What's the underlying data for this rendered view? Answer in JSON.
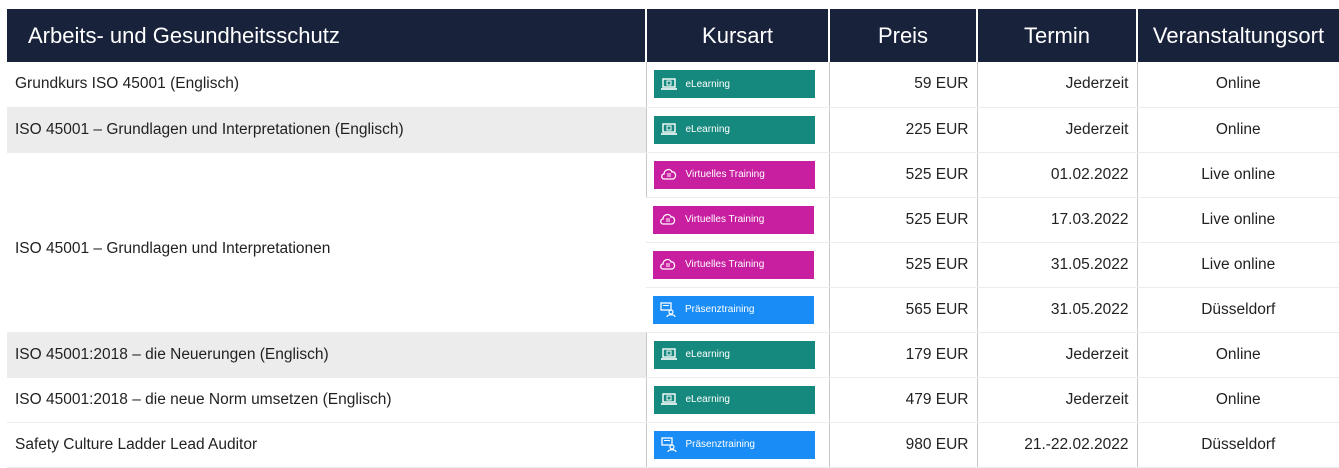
{
  "table": {
    "headers": {
      "title": "Arbeits- und Gesundheitsschutz",
      "type": "Kursart",
      "price": "Preis",
      "date": "Termin",
      "venue": "Veranstaltungsort"
    },
    "badge_types": {
      "elearning": {
        "label": "eLearning",
        "icon": "laptop-icon",
        "color": "#16897e"
      },
      "virtual": {
        "label": "Virtuelles Training",
        "icon": "cloud-document-icon",
        "color": "#c81ea0"
      },
      "presence": {
        "label": "Präsenztraining",
        "icon": "classroom-icon",
        "color": "#1a8cf5"
      }
    },
    "rows": [
      {
        "title": "Grundkurs ISO 45001 (Englisch)",
        "type_label": "eLearning",
        "price": "59 EUR",
        "date": "Jederzeit",
        "venue": "Online"
      },
      {
        "title": "ISO 45001 – Grundlagen und Interpretationen (Englisch)",
        "type_label": "eLearning",
        "price": "225 EUR",
        "date": "Jederzeit",
        "venue": "Online"
      },
      {
        "title": "ISO 45001 – Grundlagen und Interpretationen",
        "type_label": "Virtuelles Training",
        "price": "525 EUR",
        "date": "01.02.2022",
        "venue": "Live online"
      },
      {
        "title": "",
        "type_label": "Virtuelles Training",
        "price": "525 EUR",
        "date": "17.03.2022",
        "venue": "Live online"
      },
      {
        "title": "",
        "type_label": "Virtuelles Training",
        "price": "525 EUR",
        "date": "31.05.2022",
        "venue": "Live online"
      },
      {
        "title": "",
        "type_label": "Präsenztraining",
        "price": "565 EUR",
        "date": "31.05.2022",
        "venue": "Düsseldorf"
      },
      {
        "title": "ISO 45001:2018 – die Neuerungen (Englisch)",
        "type_label": "eLearning",
        "price": "179 EUR",
        "date": "Jederzeit",
        "venue": "Online"
      },
      {
        "title": "ISO 45001:2018 – die neue Norm umsetzen (Englisch)",
        "type_label": "eLearning",
        "price": "479 EUR",
        "date": "Jederzeit",
        "venue": "Online"
      },
      {
        "title": "Safety Culture Ladder Lead Auditor",
        "type_label": "Präsenztraining",
        "price": "980 EUR",
        "date": "21.-22.02.2022",
        "venue": "Düsseldorf"
      }
    ]
  }
}
